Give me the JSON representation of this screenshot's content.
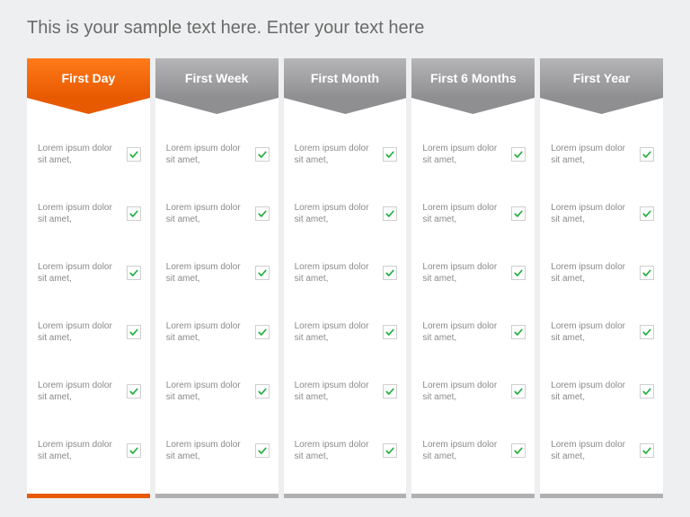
{
  "title": "This is your sample text here. Enter your text here",
  "item_text": "Lorem ipsum dolor sit amet,",
  "columns": [
    {
      "label": "First Day",
      "style": "orange",
      "items": 6
    },
    {
      "label": "First Week",
      "style": "gray",
      "items": 6
    },
    {
      "label": "First Month",
      "style": "gray",
      "items": 6
    },
    {
      "label": "First 6 Months",
      "style": "gray",
      "items": 6
    },
    {
      "label": "First Year",
      "style": "gray",
      "items": 6
    }
  ],
  "colors": {
    "accent": "#e85a00",
    "check": "#1aae3a",
    "gray_header_top": "#b5b5b7",
    "gray_header_bottom": "#8f8f92"
  }
}
